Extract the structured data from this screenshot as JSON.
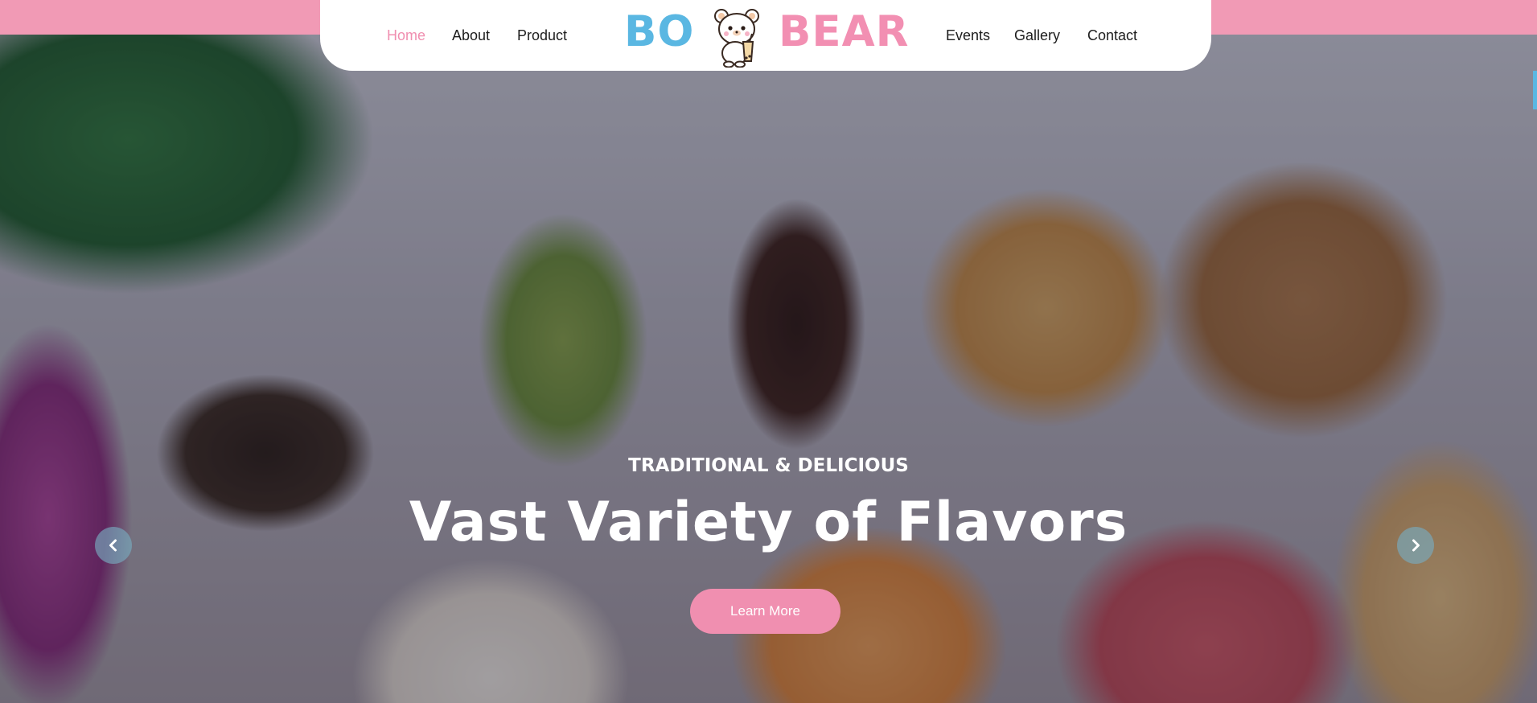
{
  "nav": {
    "left_links": [
      {
        "label": "Home",
        "active": true
      },
      {
        "label": "About",
        "active": false
      },
      {
        "label": "Product",
        "active": false
      }
    ],
    "right_links": [
      {
        "label": "Events"
      },
      {
        "label": "Gallery"
      },
      {
        "label": "Contact"
      }
    ]
  },
  "logo": {
    "part1": "BO",
    "part2": "BEAR",
    "part1_color": "#5ab7e2",
    "part2_color": "#f28fb2",
    "mascot_icon": "teddy-bear-with-boba-icon"
  },
  "hero": {
    "subtitle": "TRADITIONAL & DELICIOUS",
    "title": "Vast Variety of Flavors",
    "cta_label": "Learn More",
    "prev_icon": "chevron-left-icon",
    "next_icon": "chevron-right-icon",
    "background_image": "mochi donuts photo"
  },
  "colors": {
    "accent_pink": "#f08fb0",
    "accent_blue": "#5ab7e2",
    "topbar": "#f19ab5"
  }
}
